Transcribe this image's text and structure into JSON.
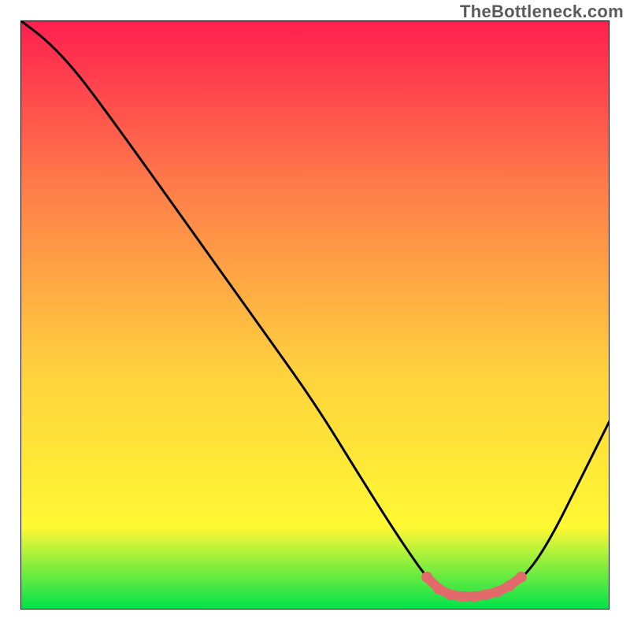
{
  "watermark": "TheBottleneck.com",
  "chart_data": {
    "type": "line",
    "title": "",
    "xlabel": "",
    "ylabel": "",
    "xlim": [
      0,
      100
    ],
    "ylim": [
      0,
      100
    ],
    "gradient": {
      "top_color": "#ff1f4f",
      "mid_colors": [
        "#ff7c4a",
        "#ffd23d",
        "#fff833"
      ],
      "bottom_color": "#00e24a"
    },
    "curve": {
      "description": "V-shaped bottleneck curve: steep descent from ~100 at x=0 to minimum ~2 near x=72-82, then rise toward ~32 at x=100",
      "points": [
        {
          "x": 0,
          "y": 100
        },
        {
          "x": 4,
          "y": 97
        },
        {
          "x": 8,
          "y": 93
        },
        {
          "x": 12,
          "y": 88
        },
        {
          "x": 20,
          "y": 77
        },
        {
          "x": 30,
          "y": 63
        },
        {
          "x": 40,
          "y": 49
        },
        {
          "x": 50,
          "y": 35
        },
        {
          "x": 58,
          "y": 22
        },
        {
          "x": 65,
          "y": 11
        },
        {
          "x": 70,
          "y": 4
        },
        {
          "x": 74,
          "y": 2
        },
        {
          "x": 78,
          "y": 2
        },
        {
          "x": 82,
          "y": 3
        },
        {
          "x": 86,
          "y": 6
        },
        {
          "x": 90,
          "y": 12
        },
        {
          "x": 95,
          "y": 22
        },
        {
          "x": 100,
          "y": 32
        }
      ]
    },
    "highlight_band": {
      "description": "Red marker band near minimum of curve",
      "points": [
        {
          "x": 69,
          "y": 5.5
        },
        {
          "x": 71,
          "y": 3.5
        },
        {
          "x": 73,
          "y": 2.5
        },
        {
          "x": 75,
          "y": 2.2
        },
        {
          "x": 77,
          "y": 2.2
        },
        {
          "x": 79,
          "y": 2.5
        },
        {
          "x": 81,
          "y": 3
        },
        {
          "x": 83,
          "y": 4
        },
        {
          "x": 85,
          "y": 5.5
        }
      ],
      "color": "#e36a6a"
    }
  }
}
